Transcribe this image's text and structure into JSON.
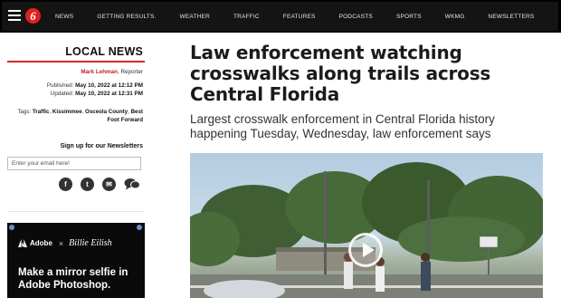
{
  "nav": {
    "items": [
      "NEWS",
      "GETTING RESULTS.",
      "WEATHER",
      "TRAFFIC",
      "FEATURES",
      "PODCASTS",
      "SPORTS",
      "WKMG",
      "NEWSLETTERS"
    ]
  },
  "sidebar": {
    "section_title": "LOCAL NEWS",
    "author_name": "Mark Lehman",
    "author_role": ", Reporter",
    "published_label": "Published:",
    "published_value": "May 10, 2022 at 12:12 PM",
    "updated_label": "Updated:",
    "updated_value": "May 10, 2022 at 12:31 PM",
    "tags_label": "Tags:",
    "tags": [
      "Traffic",
      "Kissimmee",
      "Osceola County",
      "Best Foot Forward"
    ],
    "newsletter_label": "Sign up for our Newsletters",
    "email_placeholder": "Enter your email here!",
    "social": {
      "facebook": "f",
      "twitter": "t",
      "email": "✉",
      "comments": "💬"
    }
  },
  "ad": {
    "brand": "Adobe",
    "separator": "×",
    "collab": "Billie Eilish",
    "headline": "Make a mirror selfie in Adobe Photoshop."
  },
  "article": {
    "headline": "Law enforcement watching crosswalks along trails across Central Florida",
    "subhead": "Largest crosswalk enforcement in Central Florida history happening Tuesday, Wednesday, law enforcement says"
  },
  "colors": {
    "nav_bg": "#141414",
    "accent_red": "#d62828",
    "logo_red": "#e0201c",
    "ad_bg": "#0a0a0a"
  },
  "icons": {
    "menu": "hamburger-icon",
    "logo": "news-6-logo",
    "play": "play-icon"
  }
}
